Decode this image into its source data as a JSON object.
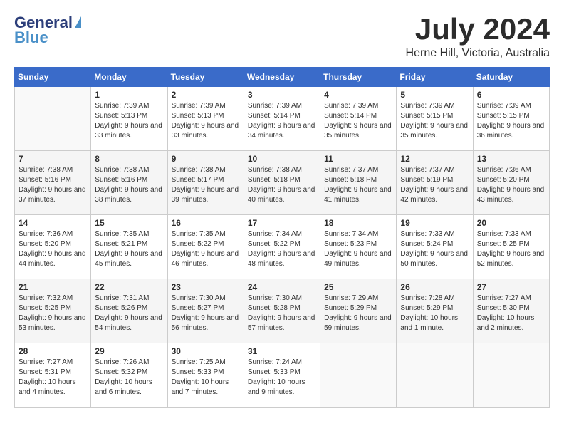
{
  "header": {
    "logo_line1": "General",
    "logo_line2": "Blue",
    "month": "July 2024",
    "location": "Herne Hill, Victoria, Australia"
  },
  "weekdays": [
    "Sunday",
    "Monday",
    "Tuesday",
    "Wednesday",
    "Thursday",
    "Friday",
    "Saturday"
  ],
  "weeks": [
    [
      {
        "day": "",
        "sunrise": "",
        "sunset": "",
        "daylight": ""
      },
      {
        "day": "1",
        "sunrise": "Sunrise: 7:39 AM",
        "sunset": "Sunset: 5:13 PM",
        "daylight": "Daylight: 9 hours and 33 minutes."
      },
      {
        "day": "2",
        "sunrise": "Sunrise: 7:39 AM",
        "sunset": "Sunset: 5:13 PM",
        "daylight": "Daylight: 9 hours and 33 minutes."
      },
      {
        "day": "3",
        "sunrise": "Sunrise: 7:39 AM",
        "sunset": "Sunset: 5:14 PM",
        "daylight": "Daylight: 9 hours and 34 minutes."
      },
      {
        "day": "4",
        "sunrise": "Sunrise: 7:39 AM",
        "sunset": "Sunset: 5:14 PM",
        "daylight": "Daylight: 9 hours and 35 minutes."
      },
      {
        "day": "5",
        "sunrise": "Sunrise: 7:39 AM",
        "sunset": "Sunset: 5:15 PM",
        "daylight": "Daylight: 9 hours and 35 minutes."
      },
      {
        "day": "6",
        "sunrise": "Sunrise: 7:39 AM",
        "sunset": "Sunset: 5:15 PM",
        "daylight": "Daylight: 9 hours and 36 minutes."
      }
    ],
    [
      {
        "day": "7",
        "sunrise": "Sunrise: 7:38 AM",
        "sunset": "Sunset: 5:16 PM",
        "daylight": "Daylight: 9 hours and 37 minutes."
      },
      {
        "day": "8",
        "sunrise": "Sunrise: 7:38 AM",
        "sunset": "Sunset: 5:16 PM",
        "daylight": "Daylight: 9 hours and 38 minutes."
      },
      {
        "day": "9",
        "sunrise": "Sunrise: 7:38 AM",
        "sunset": "Sunset: 5:17 PM",
        "daylight": "Daylight: 9 hours and 39 minutes."
      },
      {
        "day": "10",
        "sunrise": "Sunrise: 7:38 AM",
        "sunset": "Sunset: 5:18 PM",
        "daylight": "Daylight: 9 hours and 40 minutes."
      },
      {
        "day": "11",
        "sunrise": "Sunrise: 7:37 AM",
        "sunset": "Sunset: 5:18 PM",
        "daylight": "Daylight: 9 hours and 41 minutes."
      },
      {
        "day": "12",
        "sunrise": "Sunrise: 7:37 AM",
        "sunset": "Sunset: 5:19 PM",
        "daylight": "Daylight: 9 hours and 42 minutes."
      },
      {
        "day": "13",
        "sunrise": "Sunrise: 7:36 AM",
        "sunset": "Sunset: 5:20 PM",
        "daylight": "Daylight: 9 hours and 43 minutes."
      }
    ],
    [
      {
        "day": "14",
        "sunrise": "Sunrise: 7:36 AM",
        "sunset": "Sunset: 5:20 PM",
        "daylight": "Daylight: 9 hours and 44 minutes."
      },
      {
        "day": "15",
        "sunrise": "Sunrise: 7:35 AM",
        "sunset": "Sunset: 5:21 PM",
        "daylight": "Daylight: 9 hours and 45 minutes."
      },
      {
        "day": "16",
        "sunrise": "Sunrise: 7:35 AM",
        "sunset": "Sunset: 5:22 PM",
        "daylight": "Daylight: 9 hours and 46 minutes."
      },
      {
        "day": "17",
        "sunrise": "Sunrise: 7:34 AM",
        "sunset": "Sunset: 5:22 PM",
        "daylight": "Daylight: 9 hours and 48 minutes."
      },
      {
        "day": "18",
        "sunrise": "Sunrise: 7:34 AM",
        "sunset": "Sunset: 5:23 PM",
        "daylight": "Daylight: 9 hours and 49 minutes."
      },
      {
        "day": "19",
        "sunrise": "Sunrise: 7:33 AM",
        "sunset": "Sunset: 5:24 PM",
        "daylight": "Daylight: 9 hours and 50 minutes."
      },
      {
        "day": "20",
        "sunrise": "Sunrise: 7:33 AM",
        "sunset": "Sunset: 5:25 PM",
        "daylight": "Daylight: 9 hours and 52 minutes."
      }
    ],
    [
      {
        "day": "21",
        "sunrise": "Sunrise: 7:32 AM",
        "sunset": "Sunset: 5:25 PM",
        "daylight": "Daylight: 9 hours and 53 minutes."
      },
      {
        "day": "22",
        "sunrise": "Sunrise: 7:31 AM",
        "sunset": "Sunset: 5:26 PM",
        "daylight": "Daylight: 9 hours and 54 minutes."
      },
      {
        "day": "23",
        "sunrise": "Sunrise: 7:30 AM",
        "sunset": "Sunset: 5:27 PM",
        "daylight": "Daylight: 9 hours and 56 minutes."
      },
      {
        "day": "24",
        "sunrise": "Sunrise: 7:30 AM",
        "sunset": "Sunset: 5:28 PM",
        "daylight": "Daylight: 9 hours and 57 minutes."
      },
      {
        "day": "25",
        "sunrise": "Sunrise: 7:29 AM",
        "sunset": "Sunset: 5:29 PM",
        "daylight": "Daylight: 9 hours and 59 minutes."
      },
      {
        "day": "26",
        "sunrise": "Sunrise: 7:28 AM",
        "sunset": "Sunset: 5:29 PM",
        "daylight": "Daylight: 10 hours and 1 minute."
      },
      {
        "day": "27",
        "sunrise": "Sunrise: 7:27 AM",
        "sunset": "Sunset: 5:30 PM",
        "daylight": "Daylight: 10 hours and 2 minutes."
      }
    ],
    [
      {
        "day": "28",
        "sunrise": "Sunrise: 7:27 AM",
        "sunset": "Sunset: 5:31 PM",
        "daylight": "Daylight: 10 hours and 4 minutes."
      },
      {
        "day": "29",
        "sunrise": "Sunrise: 7:26 AM",
        "sunset": "Sunset: 5:32 PM",
        "daylight": "Daylight: 10 hours and 6 minutes."
      },
      {
        "day": "30",
        "sunrise": "Sunrise: 7:25 AM",
        "sunset": "Sunset: 5:33 PM",
        "daylight": "Daylight: 10 hours and 7 minutes."
      },
      {
        "day": "31",
        "sunrise": "Sunrise: 7:24 AM",
        "sunset": "Sunset: 5:33 PM",
        "daylight": "Daylight: 10 hours and 9 minutes."
      },
      {
        "day": "",
        "sunrise": "",
        "sunset": "",
        "daylight": ""
      },
      {
        "day": "",
        "sunrise": "",
        "sunset": "",
        "daylight": ""
      },
      {
        "day": "",
        "sunrise": "",
        "sunset": "",
        "daylight": ""
      }
    ]
  ]
}
